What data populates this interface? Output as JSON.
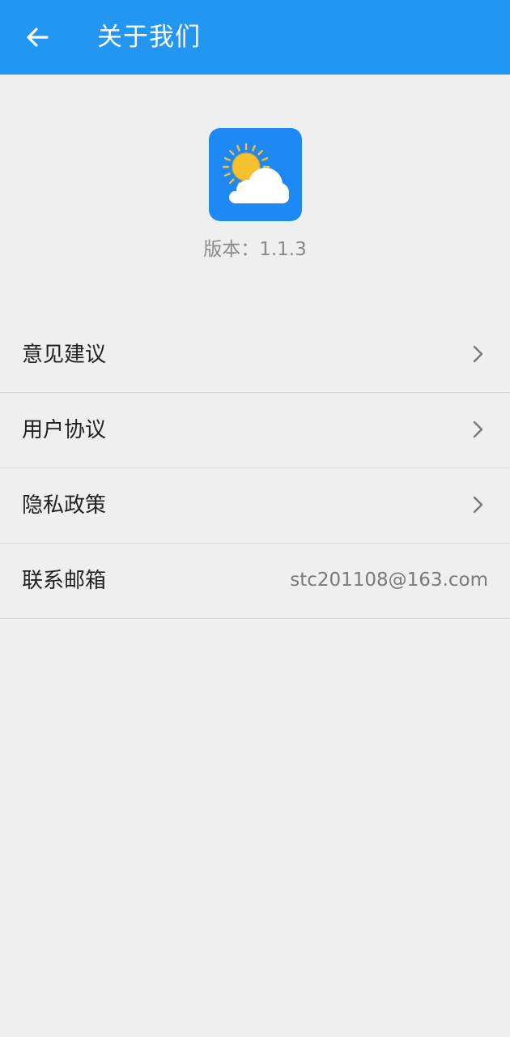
{
  "header": {
    "title": "关于我们",
    "back_icon": "arrow-left-icon",
    "background_color": "#2196f3"
  },
  "app": {
    "icon": "weather-partly-cloudy-icon",
    "version_text": "版本：1.1.3"
  },
  "menu": {
    "items": [
      {
        "label": "意见建议",
        "icon": "chevron-right-icon"
      },
      {
        "label": "用户协议",
        "icon": "chevron-right-icon"
      },
      {
        "label": "隐私政策",
        "icon": "chevron-right-icon"
      },
      {
        "label": "联系邮箱",
        "value": "stc201108@163.com"
      }
    ]
  }
}
